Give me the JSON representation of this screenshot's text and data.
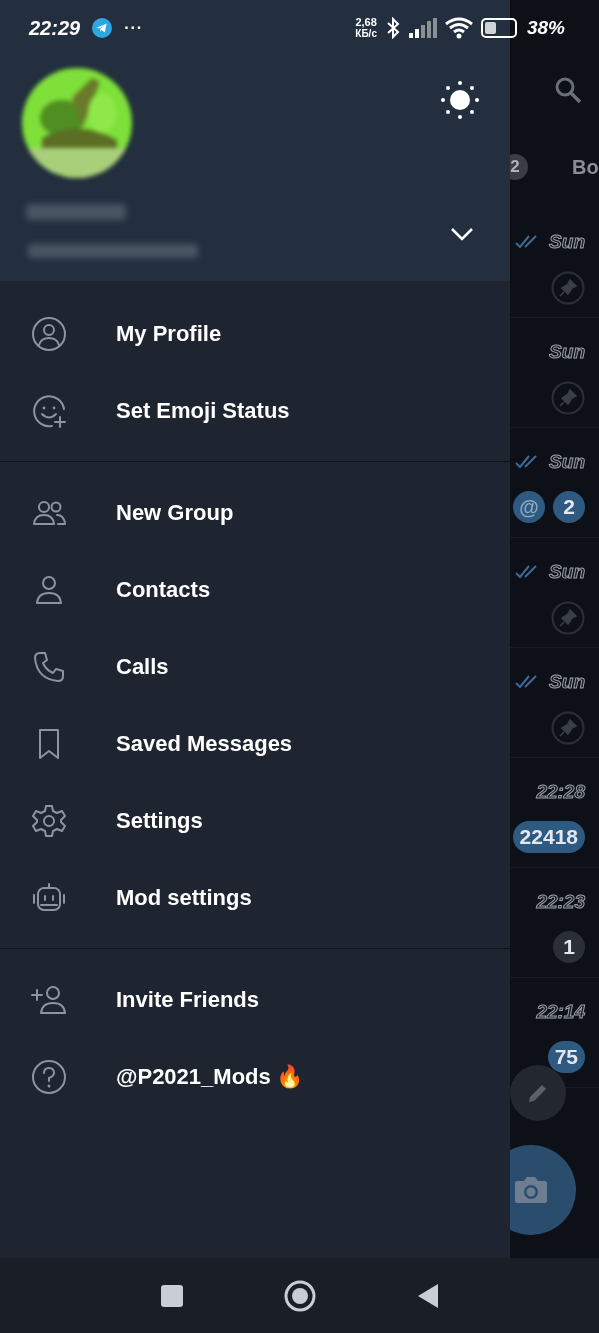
{
  "status_bar": {
    "time": "22:29",
    "more": "···",
    "net_speed": "2,68",
    "net_unit": "КБ/с",
    "battery": "38%"
  },
  "drawer": {
    "sections": [
      {
        "items": [
          {
            "kind": "profile",
            "label": "My Profile"
          },
          {
            "kind": "emoji",
            "label": "Set Emoji Status"
          }
        ]
      },
      {
        "items": [
          {
            "kind": "group",
            "label": "New Group"
          },
          {
            "kind": "contact",
            "label": "Contacts"
          },
          {
            "kind": "phone",
            "label": "Calls"
          },
          {
            "kind": "bookmark",
            "label": "Saved Messages"
          },
          {
            "kind": "gear",
            "label": "Settings"
          },
          {
            "kind": "robot",
            "label": "Mod settings"
          }
        ]
      },
      {
        "items": [
          {
            "kind": "invite",
            "label": "Invite Friends"
          },
          {
            "kind": "help",
            "label": "@P2021_Mods 🔥"
          }
        ]
      }
    ]
  },
  "chat_list": {
    "tabs": [
      {
        "badge": "2"
      },
      {
        "label": "Bo"
      }
    ],
    "rows": [
      {
        "time": "Sun",
        "read": true,
        "pinned": true
      },
      {
        "time": "Sun",
        "read": false,
        "pinned": true
      },
      {
        "time": "Sun",
        "read": true,
        "pinned": false,
        "mention": "@",
        "unread": "2"
      },
      {
        "time": "Sun",
        "read": true,
        "pinned": true
      },
      {
        "time": "Sun",
        "read": true,
        "pinned": true
      },
      {
        "time": "22:28",
        "read": false,
        "pinned": false,
        "unread": "22418"
      },
      {
        "time": "22:23",
        "read": false,
        "pinned": false,
        "unread": "1"
      },
      {
        "time": "22:14",
        "read": false,
        "pinned": false,
        "unread": "75"
      }
    ]
  }
}
